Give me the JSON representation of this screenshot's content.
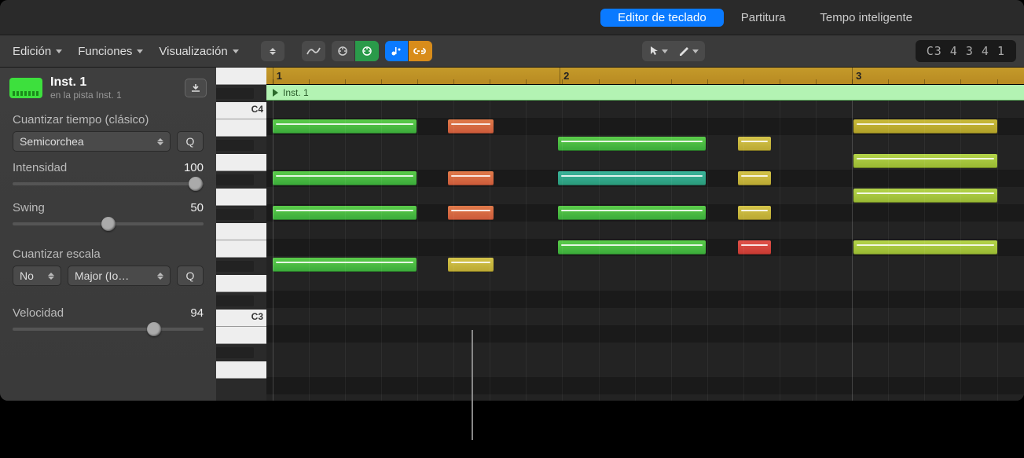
{
  "tabs": {
    "keyboard": "Editor de teclado",
    "score": "Partitura",
    "smart": "Tempo inteligente"
  },
  "menus": {
    "edit": "Edición",
    "functions": "Funciones",
    "view": "Visualización"
  },
  "position": "C3  4 3 4 1",
  "track": {
    "name": "Inst. 1",
    "sub": "en la pista Inst. 1",
    "region_name": "Inst. 1"
  },
  "inspector": {
    "quantize_label": "Cuantizar tiempo (clásico)",
    "quantize_value": "Semicorchea",
    "q_button": "Q",
    "strength_label": "Intensidad",
    "strength_value": "100",
    "swing_label": "Swing",
    "swing_value": "50",
    "scale_label": "Cuantizar escala",
    "scale_onoff": "No",
    "scale_mode": "Major (Io…",
    "velocity_label": "Velocidad",
    "velocity_value": "94"
  },
  "piano_labels": {
    "c3": "C3",
    "c4": "C4"
  },
  "ruler_bars": [
    "1",
    "2",
    "3"
  ],
  "notes": [
    {
      "lane": 2,
      "startPct": 0.8,
      "widthPct": 19,
      "color": "n-green"
    },
    {
      "lane": 2,
      "startPct": 24,
      "widthPct": 6,
      "color": "n-orange"
    },
    {
      "lane": 2,
      "startPct": 77.5,
      "widthPct": 19,
      "color": "n-yellow2"
    },
    {
      "lane": 3,
      "startPct": 38.5,
      "widthPct": 19.5,
      "color": "n-green"
    },
    {
      "lane": 3,
      "startPct": 62.2,
      "widthPct": 4.4,
      "color": "n-yellow"
    },
    {
      "lane": 4,
      "startPct": 77.5,
      "widthPct": 19,
      "color": "n-lime"
    },
    {
      "lane": 5,
      "startPct": 0.8,
      "widthPct": 19,
      "color": "n-green"
    },
    {
      "lane": 5,
      "startPct": 24,
      "widthPct": 6,
      "color": "n-orange"
    },
    {
      "lane": 5,
      "startPct": 38.5,
      "widthPct": 19.5,
      "color": "n-teal"
    },
    {
      "lane": 5,
      "startPct": 62.2,
      "widthPct": 4.4,
      "color": "n-yellow"
    },
    {
      "lane": 6,
      "startPct": 77.5,
      "widthPct": 19,
      "color": "n-lime"
    },
    {
      "lane": 7,
      "startPct": 0.8,
      "widthPct": 19,
      "color": "n-green"
    },
    {
      "lane": 7,
      "startPct": 24,
      "widthPct": 6,
      "color": "n-orange"
    },
    {
      "lane": 7,
      "startPct": 38.5,
      "widthPct": 19.5,
      "color": "n-green"
    },
    {
      "lane": 7,
      "startPct": 62.2,
      "widthPct": 4.4,
      "color": "n-yellow"
    },
    {
      "lane": 9,
      "startPct": 38.5,
      "widthPct": 19.5,
      "color": "n-green"
    },
    {
      "lane": 9,
      "startPct": 62.2,
      "widthPct": 4.4,
      "color": "n-red"
    },
    {
      "lane": 9,
      "startPct": 77.5,
      "widthPct": 19,
      "color": "n-lime"
    },
    {
      "lane": 10,
      "startPct": 0.8,
      "widthPct": 19,
      "color": "n-green"
    },
    {
      "lane": 10,
      "startPct": 24,
      "widthPct": 6,
      "color": "n-yellow"
    }
  ]
}
